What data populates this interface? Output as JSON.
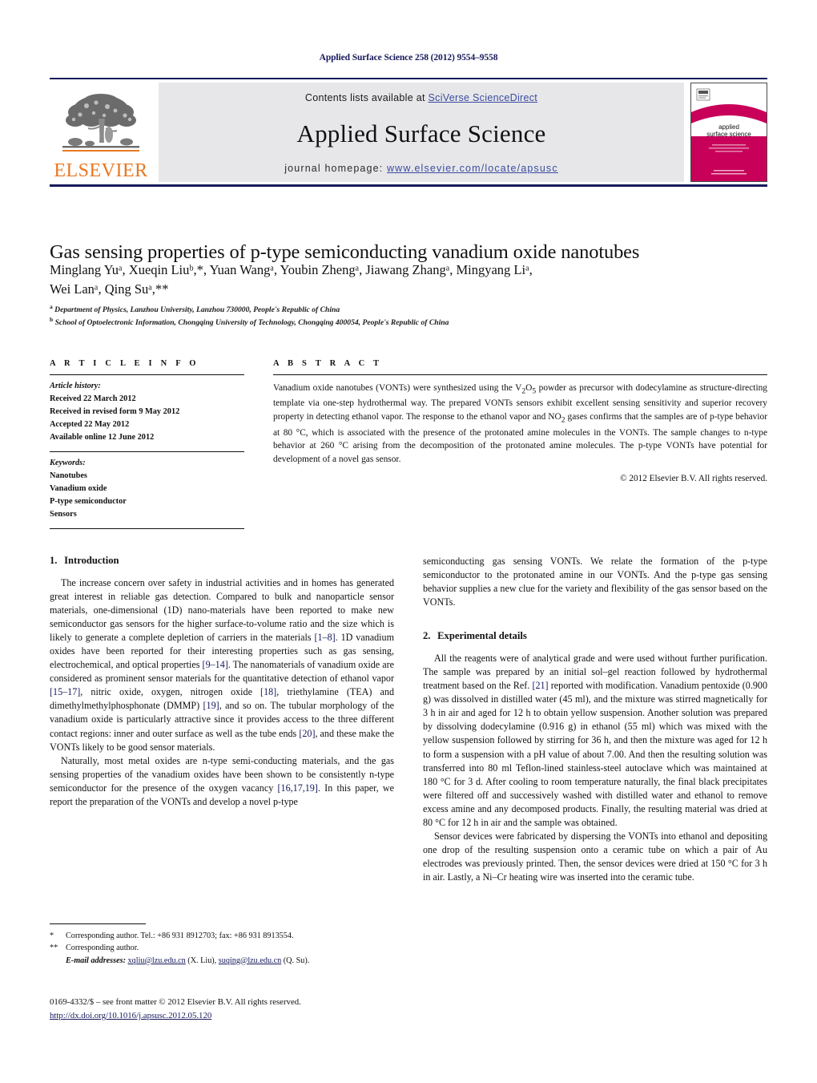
{
  "running_head": "Applied Surface Science 258 (2012) 9554–9558",
  "masthead": {
    "contents_prefix": "Contents lists available at ",
    "sciencedirect_link": "SciVerse ScienceDirect",
    "journal_title": "Applied Surface Science",
    "homepage_prefix": "journal homepage: ",
    "homepage_url": "www.elsevier.com/locate/apsusc",
    "publisher_name": "ELSEVIER",
    "cover_title_line1": "applied",
    "cover_title_line2": "surface science",
    "accent_orange": "#e87722",
    "link_blue": "#3b4ca0",
    "rule_navy": "#16195a",
    "band_gray": "#e7e7e9",
    "cover_magenta": "#c8005a"
  },
  "article": {
    "title": "Gas sensing properties of p-type semiconducting vanadium oxide nanotubes",
    "authors_line1": "Minglang Yuᵃ, Xueqin Liuᵇ,*, Yuan Wangᵃ, Youbin Zhengᵃ, Jiawang Zhangᵃ, Mingyang Liᵃ,",
    "authors_line2": "Wei Lanᵃ, Qing Suᵃ,**",
    "authors": [
      {
        "name": "Minglang Yu",
        "sup": "a"
      },
      {
        "name": "Xueqin Liu",
        "sup": "b,*"
      },
      {
        "name": "Yuan Wang",
        "sup": "a"
      },
      {
        "name": "Youbin Zheng",
        "sup": "a"
      },
      {
        "name": "Jiawang Zhang",
        "sup": "a"
      },
      {
        "name": "Mingyang Li",
        "sup": "a"
      },
      {
        "name": "Wei Lan",
        "sup": "a"
      },
      {
        "name": "Qing Su",
        "sup": "a,**"
      }
    ],
    "affiliations": [
      {
        "mark": "a",
        "text": "Department of Physics, Lanzhou University, Lanzhou 730000, People's Republic of China"
      },
      {
        "mark": "b",
        "text": "School of Optoelectronic Information, Chongqing University of Technology, Chongqing 400054, People's Republic of China"
      }
    ]
  },
  "article_info": {
    "heading": "A R T I C L E   I N F O",
    "history_label": "Article history:",
    "history": [
      "Received 22 March 2012",
      "Received in revised form 9 May 2012",
      "Accepted 22 May 2012",
      "Available online 12 June 2012"
    ],
    "keywords_label": "Keywords:",
    "keywords": [
      "Nanotubes",
      "Vanadium oxide",
      "P-type semiconductor",
      "Sensors"
    ]
  },
  "abstract": {
    "heading": "A B S T R A C T",
    "text": "Vanadium oxide nanotubes (VONTs) were synthesized using the V2O5 powder as precursor with dodecylamine as structure-directing template via one-step hydrothermal way. The prepared VONTs sensors exhibit excellent sensing sensitivity and superior recovery property in detecting ethanol vapor. The response to the ethanol vapor and NO2 gases confirms that the samples are of p-type behavior at 80 °C, which is associated with the presence of the protonated amine molecules in the VONTs. The sample changes to n-type behavior at 260 °C arising from the decomposition of the protonated amine molecules. The p-type VONTs have potential for development of a novel gas sensor.",
    "copyright": "© 2012 Elsevier B.V. All rights reserved."
  },
  "sections": {
    "introduction": {
      "number": "1.",
      "title": "Introduction",
      "paragraphs": [
        "The increase concern over safety in industrial activities and in homes has generated great interest in reliable gas detection. Compared to bulk and nanoparticle sensor materials, one-dimensional (1D) nano-materials have been reported to make new semiconductor gas sensors for the higher surface-to-volume ratio and the size which is likely to generate a complete depletion of carriers in the materials [1–8]. 1D vanadium oxides have been reported for their interesting properties such as gas sensing, electrochemical, and optical properties [9–14]. The nanomaterials of vanadium oxide are considered as prominent sensor materials for the quantitative detection of ethanol vapor [15–17], nitric oxide, oxygen, nitrogen oxide [18], triethylamine (TEA) and dimethylmethylphosphonate (DMMP) [19], and so on. The tubular morphology of the vanadium oxide is particularly attractive since it provides access to the three different contact regions: inner and outer surface as well as the tube ends [20], and these make the VONTs likely to be good sensor materials.",
        "Naturally, most metal oxides are n-type semi-conducting materials, and the gas sensing properties of the vanadium oxides have been shown to be consistently n-type semiconductor for the presence of the oxygen vacancy [16,17,19]. In this paper, we report the preparation of the VONTs and develop a novel p-type semiconducting gas sensing VONTs. We relate the formation of the p-type semiconductor to the protonated amine in our VONTs. And the p-type gas sensing behavior supplies a new clue for the variety and flexibility of the gas sensor based on the VONTs."
      ]
    },
    "experimental": {
      "number": "2.",
      "title": "Experimental details",
      "paragraphs": [
        "All the reagents were of analytical grade and were used without further purification. The sample was prepared by an initial sol–gel reaction followed by hydrothermal treatment based on the Ref. [21] reported with modification. Vanadium pentoxide (0.900 g) was dissolved in distilled water (45 ml), and the mixture was stirred magnetically for 3 h in air and aged for 12 h to obtain yellow suspension. Another solution was prepared by dissolving dodecylamine (0.916 g) in ethanol (55 ml) which was mixed with the yellow suspension followed by stirring for 36 h, and then the mixture was aged for 12 h to form a suspension with a pH value of about 7.00. And then the resulting solution was transferred into 80 ml Teflon-lined stainless-steel autoclave which was maintained at 180 °C for 3 d. After cooling to room temperature naturally, the final black precipitates were filtered off and successively washed with distilled water and ethanol to remove excess amine and any decomposed products. Finally, the resulting material was dried at 80 °C for 12 h in air and the sample was obtained.",
        "Sensor devices were fabricated by dispersing the VONTs into ethanol and depositing one drop of the resulting suspension onto a ceramic tube on which a pair of Au electrodes was previously printed. Then, the sensor devices were dried at 150 °C for 3 h in air. Lastly, a Ni–Cr heating wire was inserted into the ceramic tube."
      ]
    }
  },
  "footnotes": {
    "line1_mark": "*",
    "line1_text": "Corresponding author. Tel.: +86 931 8912703; fax: +86 931 8913554.",
    "line2_mark": "**",
    "line2_text": "Corresponding author.",
    "email_label": "E-mail addresses:",
    "email1": "xqliu@lzu.edu.cn",
    "email1_who": "(X. Liu),",
    "email2": "suqing@lzu.edu.cn",
    "email2_who": "(Q. Su)."
  },
  "imprint": {
    "issn_line": "0169-4332/$ – see front matter © 2012 Elsevier B.V. All rights reserved.",
    "doi": "http://dx.doi.org/10.1016/j.apsusc.2012.05.120"
  }
}
